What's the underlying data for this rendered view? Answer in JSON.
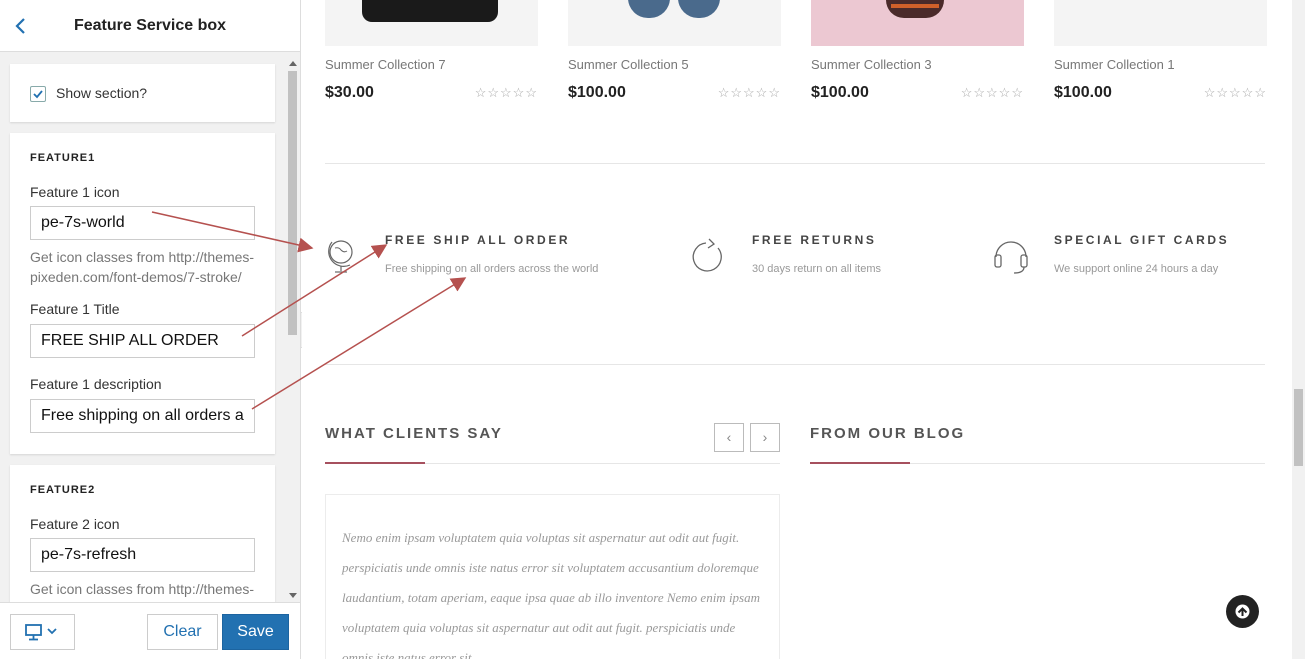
{
  "sidebar": {
    "title": "Feature Service box",
    "show_section_label": "Show section?",
    "feature1": {
      "heading": "FEATURE1",
      "icon_label": "Feature 1 icon",
      "icon_value": "pe-7s-world",
      "icon_help": "Get icon classes from http://themes-pixeden.com/font-demos/7-stroke/",
      "title_label": "Feature 1 Title",
      "title_value": "FREE SHIP ALL ORDER",
      "desc_label": "Feature 1 description",
      "desc_value": "Free shipping on all orders a"
    },
    "feature2": {
      "heading": "FEATURE2",
      "icon_label": "Feature 2 icon",
      "icon_value": "pe-7s-refresh",
      "icon_help": "Get icon classes from http://themes-"
    },
    "footer": {
      "clear_label": "Clear",
      "save_label": "Save"
    }
  },
  "products": [
    {
      "name": "Summer Collection 7",
      "price": "$30.00",
      "rating": 0
    },
    {
      "name": "Summer Collection 5",
      "price": "$100.00",
      "rating": 0
    },
    {
      "name": "Summer Collection 3",
      "price": "$100.00",
      "rating": 0
    },
    {
      "name": "Summer Collection 1",
      "price": "$100.00",
      "rating": 0
    }
  ],
  "stars_text": "☆☆☆☆☆",
  "features": [
    {
      "title": "FREE SHIP ALL ORDER",
      "desc": "Free shipping on all orders across the world",
      "icon": "globe-icon"
    },
    {
      "title": "FREE RETURNS",
      "desc": "30 days return on all items",
      "icon": "refresh-icon"
    },
    {
      "title": "SPECIAL GIFT CARDS",
      "desc": "We support online 24 hours a day",
      "icon": "headset-icon"
    }
  ],
  "clients_heading": "WHAT CLIENTS SAY",
  "blog_heading": "FROM OUR BLOG",
  "testimonial": "Nemo enim ipsam voluptatem quia voluptas sit aspernatur aut odit aut fugit. perspiciatis unde omnis iste natus error sit voluptatem accusantium doloremque laudantium, totam aperiam, eaque ipsa quae ab illo inventore Nemo enim ipsam voluptatem quia voluptas sit aspernatur aut odit aut fugit. perspiciatis unde omnis iste natus error sit",
  "colors": {
    "accent": "#2271b1",
    "annotation_arrow": "#b5514f",
    "section_accent": "#a6505e"
  }
}
